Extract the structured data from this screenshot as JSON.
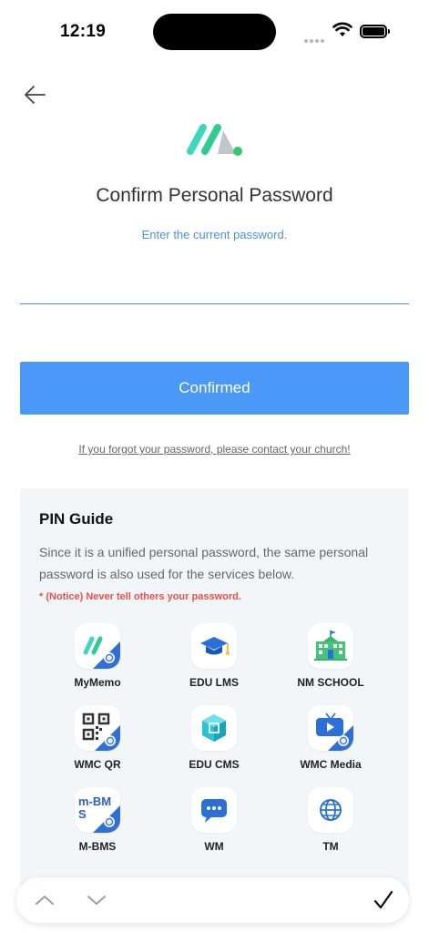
{
  "status_bar": {
    "time": "12:19"
  },
  "header": {
    "title": "Confirm Personal Password",
    "subtitle": "Enter the current password."
  },
  "password_field": {
    "value": "",
    "placeholder": ""
  },
  "confirm_button": {
    "label": "Confirmed"
  },
  "forgot_link": {
    "label": "If you forgot your password, please contact your church!"
  },
  "pin_guide": {
    "title": "PIN Guide",
    "description": "Since it is a unified personal password, the same personal password is also used for the services below.",
    "notice": "* (Notice) Never tell others your password.",
    "services": [
      {
        "label": "MyMemo",
        "icon": "mymemo-icon"
      },
      {
        "label": "EDU LMS",
        "icon": "graduation-cap-icon"
      },
      {
        "label": "NM SCHOOL",
        "icon": "school-building-icon"
      },
      {
        "label": "WMC QR",
        "icon": "qr-code-icon"
      },
      {
        "label": "EDU CMS",
        "icon": "cube-icon"
      },
      {
        "label": "WMC Media",
        "icon": "media-tv-icon"
      },
      {
        "label": "M-BMS",
        "icon": "m-bms-icon",
        "icon_text": "m-BMS"
      },
      {
        "label": "WM",
        "icon": "chat-bubble-icon"
      },
      {
        "label": "TM",
        "icon": "globe-icon"
      }
    ]
  },
  "colors": {
    "accent": "#4a98f7",
    "link_blue": "#4a90e2",
    "notice_red": "#e8504a",
    "card_bg": "#f3f6f9",
    "logo_green": "#2ecc8f",
    "logo_teal": "#3dd6c0"
  }
}
